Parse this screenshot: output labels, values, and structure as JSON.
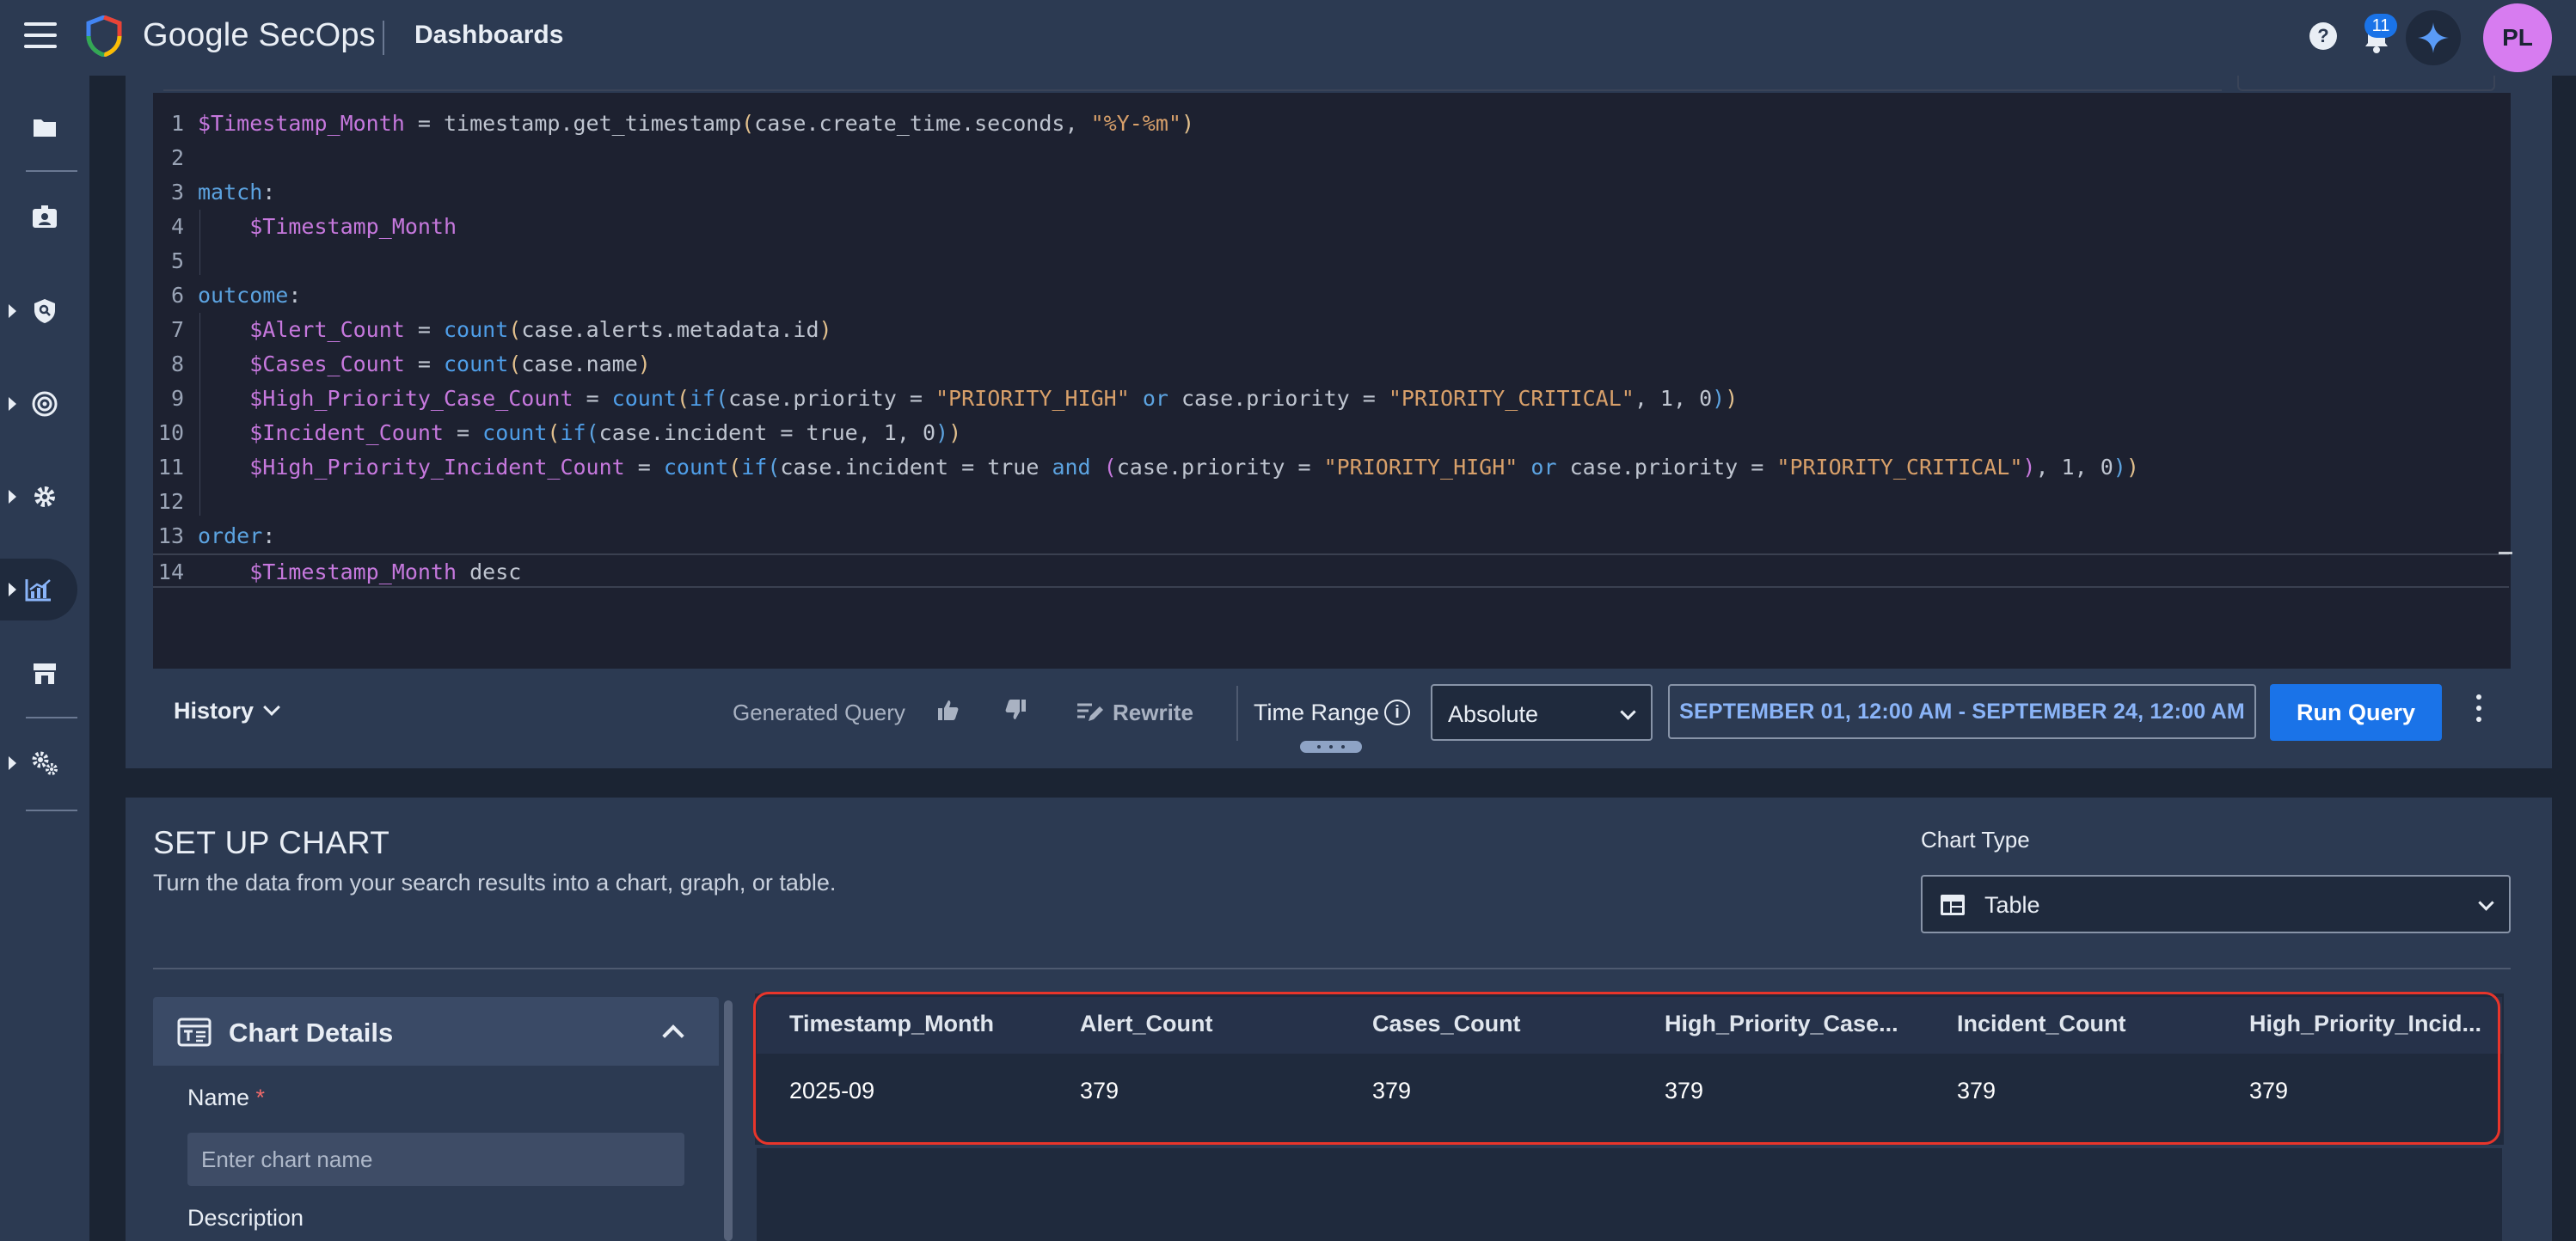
{
  "header": {
    "brand": "Google SecOps",
    "page": "Dashboards",
    "notifications_count": "11",
    "avatar_initials": "PL"
  },
  "siderail": {
    "items": [
      {
        "name": "cases-folder-icon",
        "has_caret": false
      },
      {
        "name": "alerts-badge-icon",
        "has_caret": false
      },
      {
        "name": "detection-shield-icon",
        "has_caret": true
      },
      {
        "name": "threat-radar-icon",
        "has_caret": true
      },
      {
        "name": "settings-gear-icon",
        "has_caret": true
      },
      {
        "name": "dashboards-chart-icon",
        "has_caret": true,
        "active": true
      },
      {
        "name": "marketplace-store-icon",
        "has_caret": false
      },
      {
        "name": "admin-settings-icon",
        "has_caret": true
      }
    ]
  },
  "editor": {
    "lines": [
      {
        "n": "1",
        "tokens": [
          [
            "v",
            "$Timestamp_Month"
          ],
          [
            "n",
            " = timestamp.get_timestamp"
          ],
          [
            "p",
            "("
          ],
          [
            "n",
            "case.create_time.seconds, "
          ],
          [
            "s",
            "\"%Y-%m\""
          ],
          [
            "p",
            ")"
          ]
        ]
      },
      {
        "n": "2",
        "tokens": []
      },
      {
        "n": "3",
        "tokens": [
          [
            "k",
            "match"
          ],
          [
            "n",
            ":"
          ]
        ]
      },
      {
        "n": "4",
        "tokens": [
          [
            "n",
            "    "
          ],
          [
            "v",
            "$Timestamp_Month"
          ]
        ]
      },
      {
        "n": "5",
        "tokens": []
      },
      {
        "n": "6",
        "tokens": [
          [
            "k",
            "outcome"
          ],
          [
            "n",
            ":"
          ]
        ]
      },
      {
        "n": "7",
        "tokens": [
          [
            "n",
            "    "
          ],
          [
            "v",
            "$Alert_Count"
          ],
          [
            "n",
            " = "
          ],
          [
            "f",
            "count"
          ],
          [
            "p",
            "("
          ],
          [
            "n",
            "case.alerts.metadata.id"
          ],
          [
            "p",
            ")"
          ]
        ]
      },
      {
        "n": "8",
        "tokens": [
          [
            "n",
            "    "
          ],
          [
            "v",
            "$Cases_Count"
          ],
          [
            "n",
            " = "
          ],
          [
            "f",
            "count"
          ],
          [
            "p",
            "("
          ],
          [
            "n",
            "case.name"
          ],
          [
            "p",
            ")"
          ]
        ]
      },
      {
        "n": "9",
        "tokens": [
          [
            "n",
            "    "
          ],
          [
            "v",
            "$High_Priority_Case_Count"
          ],
          [
            "n",
            " = "
          ],
          [
            "f",
            "count"
          ],
          [
            "p",
            "("
          ],
          [
            "f",
            "if"
          ],
          [
            "k",
            "("
          ],
          [
            "n",
            "case.priority = "
          ],
          [
            "s",
            "\"PRIORITY_HIGH\""
          ],
          [
            "n",
            " "
          ],
          [
            "k",
            "or"
          ],
          [
            "n",
            " case.priority = "
          ],
          [
            "s",
            "\"PRIORITY_CRITICAL\""
          ],
          [
            "n",
            ", 1, 0"
          ],
          [
            "k",
            ")"
          ],
          [
            "p",
            ")"
          ]
        ]
      },
      {
        "n": "10",
        "tokens": [
          [
            "n",
            "    "
          ],
          [
            "v",
            "$Incident_Count"
          ],
          [
            "n",
            " = "
          ],
          [
            "f",
            "count"
          ],
          [
            "p",
            "("
          ],
          [
            "f",
            "if"
          ],
          [
            "k",
            "("
          ],
          [
            "n",
            "case.incident = true, 1, 0"
          ],
          [
            "k",
            ")"
          ],
          [
            "p",
            ")"
          ]
        ]
      },
      {
        "n": "11",
        "tokens": [
          [
            "n",
            "    "
          ],
          [
            "v",
            "$High_Priority_Incident_Count"
          ],
          [
            "n",
            " = "
          ],
          [
            "f",
            "count"
          ],
          [
            "p",
            "("
          ],
          [
            "f",
            "if"
          ],
          [
            "k",
            "("
          ],
          [
            "n",
            "case.incident = true "
          ],
          [
            "k",
            "and"
          ],
          [
            "n",
            " "
          ],
          [
            "v",
            "("
          ],
          [
            "n",
            "case.priority = "
          ],
          [
            "s",
            "\"PRIORITY_HIGH\""
          ],
          [
            "n",
            " "
          ],
          [
            "k",
            "or"
          ],
          [
            "n",
            " case.priority = "
          ],
          [
            "s",
            "\"PRIORITY_CRITICAL\""
          ],
          [
            "v",
            ")"
          ],
          [
            "n",
            ", 1, 0"
          ],
          [
            "k",
            ")"
          ],
          [
            "p",
            ")"
          ]
        ]
      },
      {
        "n": "12",
        "tokens": []
      },
      {
        "n": "13",
        "tokens": [
          [
            "k",
            "order"
          ],
          [
            "n",
            ":"
          ]
        ]
      },
      {
        "n": "14",
        "tokens": [
          [
            "n",
            "    "
          ],
          [
            "v",
            "$Timestamp_Month"
          ],
          [
            "n",
            " desc"
          ]
        ]
      }
    ]
  },
  "toolbar": {
    "history_label": "History",
    "generated_query_label": "Generated Query",
    "rewrite_label": "Rewrite",
    "time_range_label": "Time Range",
    "time_mode": "Absolute",
    "date_range": "SEPTEMBER 01, 12:00 AM - SEPTEMBER 24, 12:00 AM",
    "run_label": "Run Query"
  },
  "setup": {
    "title": "SET UP CHART",
    "subtitle": "Turn the data from your search results into a chart, graph, or table.",
    "chart_type_label": "Chart Type",
    "chart_type_value": "Table",
    "details_title": "Chart Details",
    "name_label": "Name",
    "name_required_mark": "*",
    "name_placeholder": "Enter chart name",
    "description_label": "Description"
  },
  "results": {
    "columns": [
      "Timestamp_Month",
      "Alert_Count",
      "Cases_Count",
      "High_Priority_Case...",
      "Incident_Count",
      "High_Priority_Incid..."
    ],
    "rows": [
      [
        "2025-09",
        "379",
        "379",
        "379",
        "379",
        "379"
      ]
    ]
  },
  "colors": {
    "accent": "#1a73e8",
    "highlight": "#e8352b",
    "avatar": "#d77cf0"
  }
}
